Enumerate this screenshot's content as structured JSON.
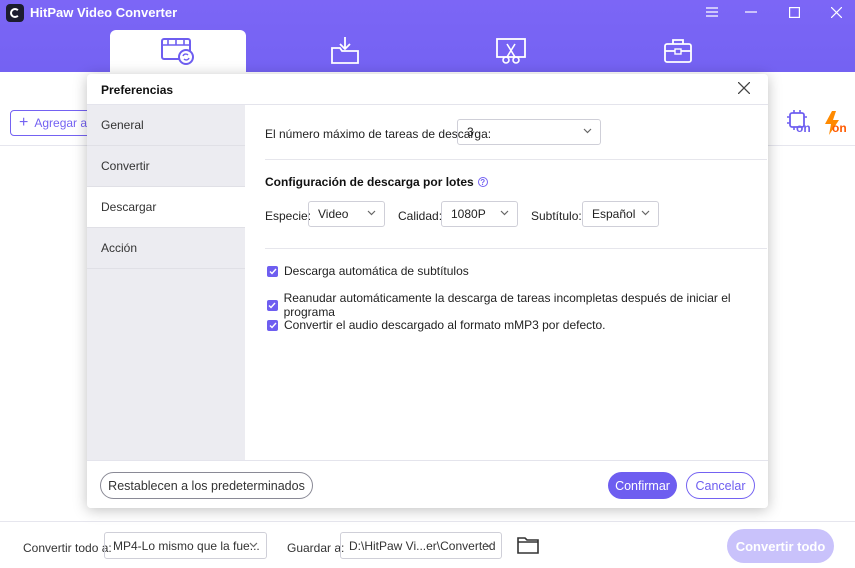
{
  "app": {
    "title": "HitPaw Video Converter",
    "accent_color": "#7462f2",
    "nav_tabs": [
      {
        "icon": "film-convert-icon",
        "active": true
      },
      {
        "icon": "download-folder-icon",
        "active": false
      },
      {
        "icon": "scissors-edit-icon",
        "active": false
      },
      {
        "icon": "toolbox-icon",
        "active": false
      }
    ],
    "window_controls": [
      "menu-icon",
      "minimize-icon",
      "maximize-icon",
      "close-icon"
    ]
  },
  "toolbar": {
    "add_label": "Agregar arc",
    "hw_accel_label": "on",
    "fast_label": "on"
  },
  "footer": {
    "convert_all_label": "Convertir todo a:",
    "convert_all_value": "MP4-Lo mismo que la fue...",
    "save_label": "Guardar a:",
    "save_path": "D:\\HitPaw Vi...er\\Converted",
    "convert_button": "Convertir todo"
  },
  "modal": {
    "title": "Preferencias",
    "sidebar": [
      {
        "label": "General",
        "active": false
      },
      {
        "label": "Convertir",
        "active": false
      },
      {
        "label": "Descargar",
        "active": true
      },
      {
        "label": "Acción",
        "active": false
      }
    ],
    "max_tasks_label": "El número máximo de tareas de descarga:",
    "max_tasks_value": "3",
    "batch_title": "Configuración de descarga por lotes",
    "kind_label": "Especie:",
    "kind_value": "Video",
    "quality_label": "Calidad:",
    "quality_value": "1080P",
    "subtitle_label": "Subtítulo:",
    "subtitle_value": "Español",
    "checkboxes": [
      {
        "label": "Descarga automática de subtítulos",
        "checked": true
      },
      {
        "label": "Reanudar automáticamente la descarga de tareas incompletas después de iniciar el programa",
        "checked": true
      },
      {
        "label": "Convertir el audio descargado al formato mMP3 por defecto.",
        "checked": true
      }
    ],
    "reset_button": "Restablecen a los predeterminados",
    "confirm_button": "Confirmar",
    "cancel_button": "Cancelar"
  }
}
